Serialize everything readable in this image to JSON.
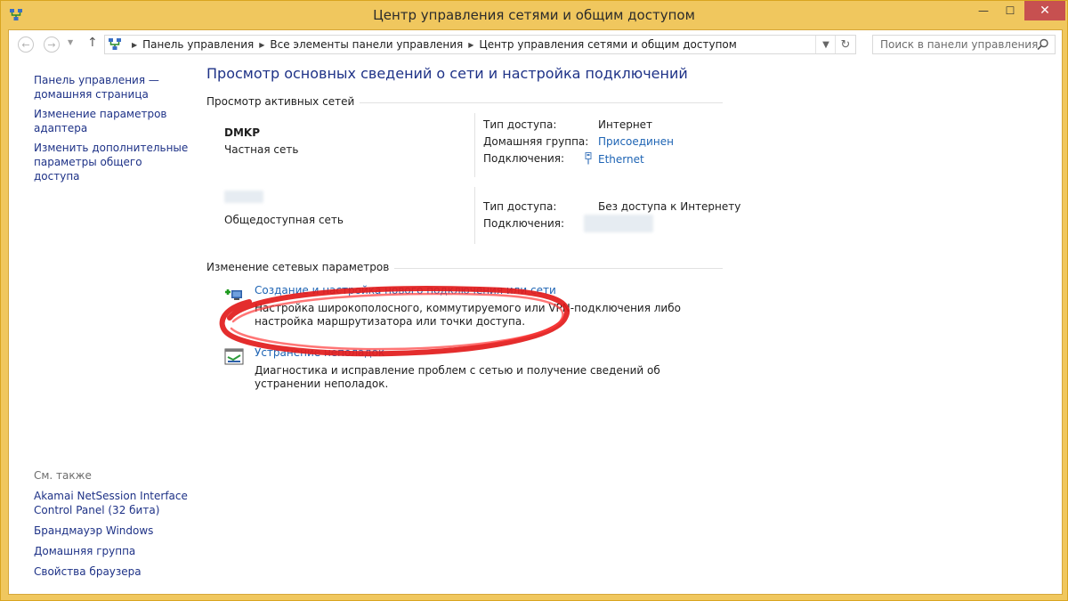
{
  "window": {
    "title": "Центр управления сетями и общим доступом",
    "minimize_glyph": "—",
    "maximize_glyph": "☐",
    "close_glyph": "✕"
  },
  "nav": {
    "back_glyph": "←",
    "forward_glyph": "→",
    "history_glyph": "▼",
    "up_glyph": "↑",
    "breadcrumb": [
      "Панель управления",
      "Все элементы панели управления",
      "Центр управления сетями и общим доступом"
    ],
    "separator_glyph": "▶",
    "address_dropdown_glyph": "▼",
    "refresh_glyph": "↻",
    "search_placeholder": "Поиск в панели управления"
  },
  "sidebar": {
    "links": [
      "Панель управления — домашняя страница",
      "Изменение параметров адаптера",
      "Изменить дополнительные параметры общего доступа"
    ],
    "see_also_title": "См. также",
    "see_also_links": [
      "Akamai NetSession Interface Control Panel (32 бита)",
      "Брандмауэр Windows",
      "Домашняя группа",
      "Свойства браузера"
    ]
  },
  "main": {
    "title": "Просмотр основных сведений о сети и настройка подключений",
    "active_networks_header": "Просмотр активных сетей",
    "networks": [
      {
        "name": "DMKP",
        "category": "Частная сеть",
        "access_type_label": "Тип доступа:",
        "access_type_value": "Интернет",
        "homegroup_label": "Домашняя группа:",
        "homegroup_value": "Присоединен",
        "connections_label": "Подключения:",
        "connections_value": "Ethernet"
      },
      {
        "name": "",
        "category": "Общедоступная сеть",
        "access_type_label": "Тип доступа:",
        "access_type_value": "Без доступа к Интернету",
        "connections_label": "Подключения:",
        "connections_value": ""
      }
    ],
    "change_settings_header": "Изменение сетевых параметров",
    "tasks": [
      {
        "link": "Создание и настройка нового подключения или сети",
        "description": "Настройка широкополосного, коммутируемого или VPN-подключения либо настройка маршрутизатора или точки доступа.",
        "icon": "new-connection-icon"
      },
      {
        "link": "Устранение неполадок",
        "description": "Диагностика и исправление проблем с сетью и получение сведений об устранении неполадок.",
        "icon": "troubleshoot-icon"
      }
    ]
  },
  "colors": {
    "frame": "#f0c75e",
    "link": "#1e64b4",
    "nav_link": "#1e3287",
    "close_button": "#c75050",
    "annotation": "#e21b1b"
  }
}
